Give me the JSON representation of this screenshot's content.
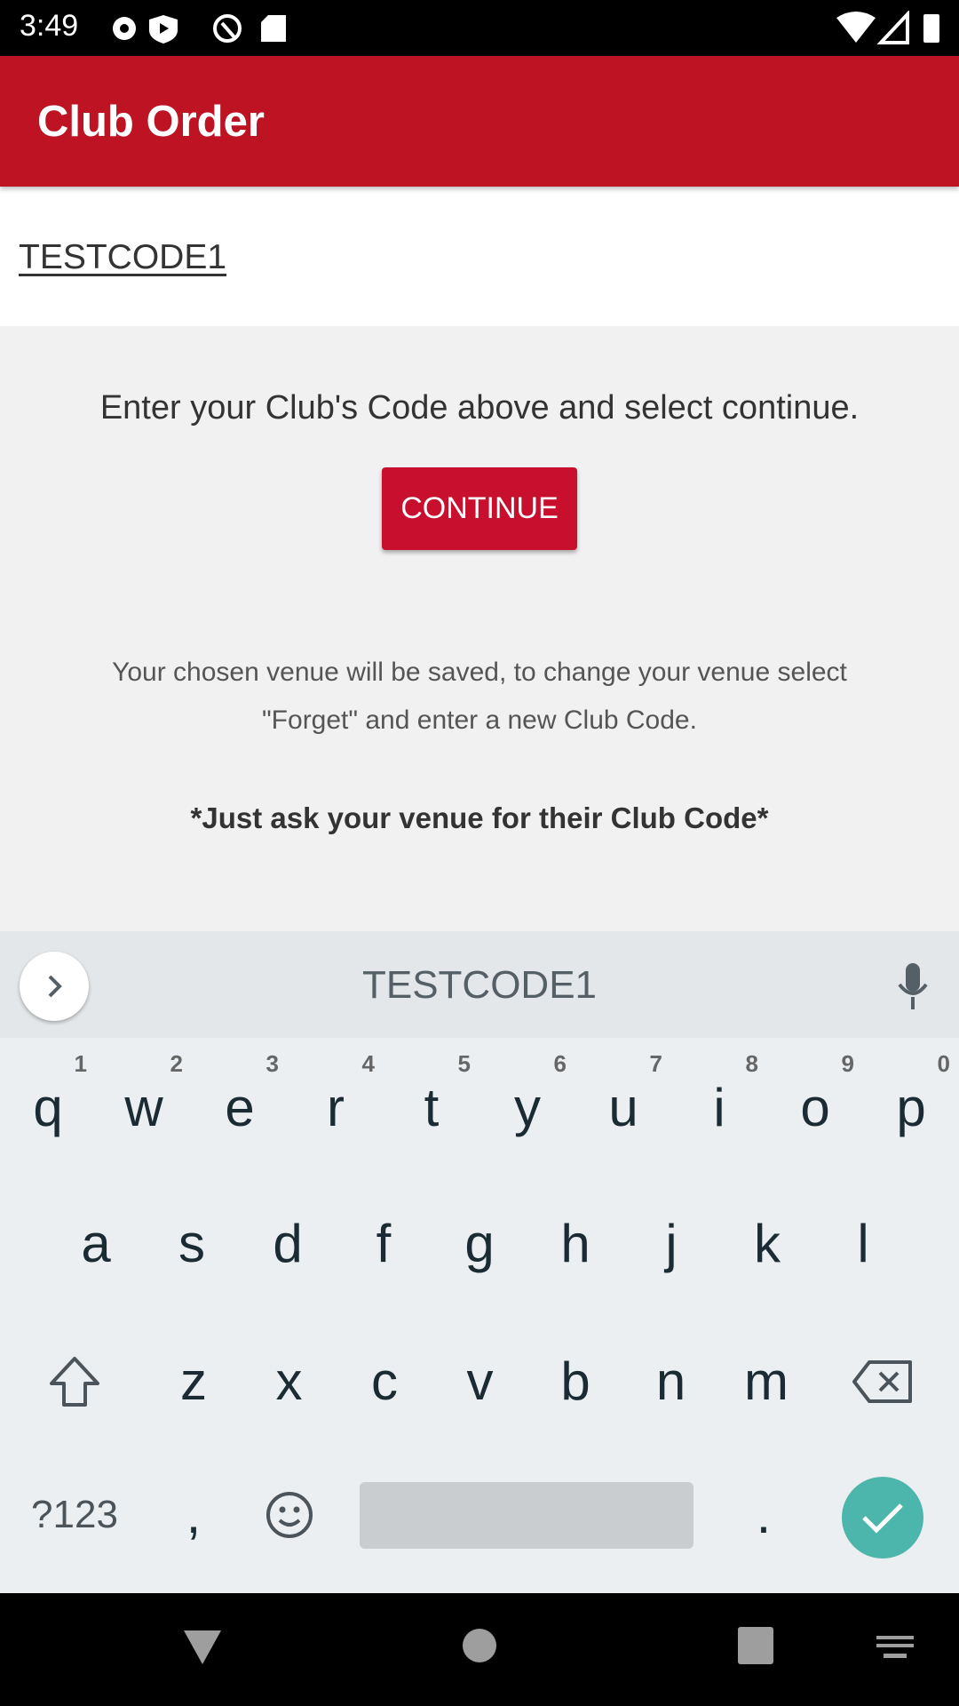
{
  "status_bar": {
    "time": "3:49",
    "icons": [
      "gear-icon",
      "shield-play-icon",
      "quick-icon",
      "sd-card-icon",
      "wifi-icon",
      "signal-icon",
      "battery-icon"
    ]
  },
  "app_bar": {
    "title": "Club Order"
  },
  "code_field": {
    "value": "TESTCODE1"
  },
  "main": {
    "instruction": "Enter your Club's Code above and select continue.",
    "continue_label": "CONTINUE",
    "venue_line1": "Your chosen venue will be saved, to change your venue select",
    "venue_line2": "\"Forget\" and enter a new Club Code.",
    "ask_note": "*Just ask your venue for their Club Code*"
  },
  "keyboard": {
    "suggestion": "TESTCODE1",
    "row1": [
      "q",
      "w",
      "e",
      "r",
      "t",
      "y",
      "u",
      "i",
      "o",
      "p"
    ],
    "row1_hints": [
      "1",
      "2",
      "3",
      "4",
      "5",
      "6",
      "7",
      "8",
      "9",
      "0"
    ],
    "row2": [
      "a",
      "s",
      "d",
      "f",
      "g",
      "h",
      "j",
      "k",
      "l"
    ],
    "row3": [
      "z",
      "x",
      "c",
      "v",
      "b",
      "n",
      "m"
    ],
    "symbols_label": "?123",
    "comma": ",",
    "period": ".",
    "enter_color": "#4db6ac"
  },
  "colors": {
    "accent": "#bd1323",
    "button": "#c8102e"
  }
}
